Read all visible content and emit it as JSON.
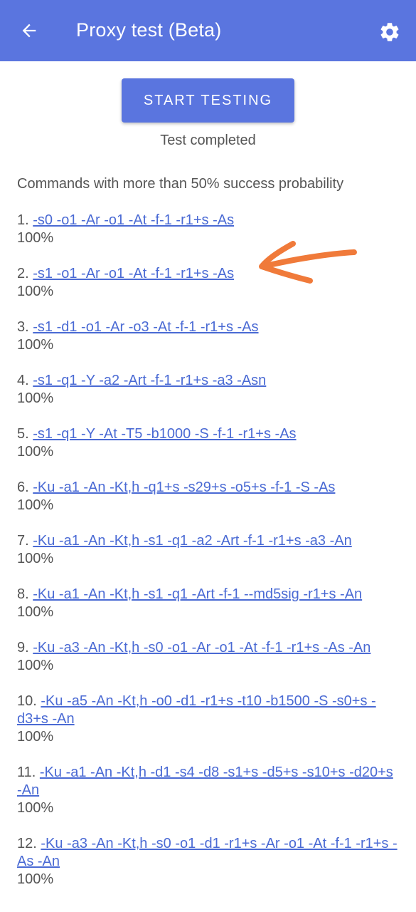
{
  "appbar": {
    "title": "Proxy test (Beta)",
    "back_icon": "arrow-back-icon",
    "settings_icon": "gear-icon",
    "color": "#5a75df"
  },
  "main": {
    "start_button_label": "START TESTING",
    "status": "Test completed",
    "heading": "Commands with more than 50% success probability",
    "results": [
      {
        "num": "1.",
        "command": "-s0 -o1 -Ar -o1 -At -f-1 -r1+s -As",
        "percent": "100%"
      },
      {
        "num": "2.",
        "command": "-s1 -o1 -Ar -o1 -At -f-1 -r1+s -As",
        "percent": "100%"
      },
      {
        "num": "3.",
        "command": "-s1 -d1 -o1 -Ar -o3 -At -f-1 -r1+s -As",
        "percent": "100%"
      },
      {
        "num": "4.",
        "command": "-s1 -q1 -Y -a2 -Art -f-1 -r1+s -a3 -Asn",
        "percent": "100%"
      },
      {
        "num": "5.",
        "command": "-s1 -q1 -Y -At -T5 -b1000 -S -f-1 -r1+s -As",
        "percent": "100%"
      },
      {
        "num": "6.",
        "command": "-Ku -a1 -An -Kt,h -q1+s -s29+s -o5+s -f-1 -S -As",
        "percent": "100%"
      },
      {
        "num": "7.",
        "command": "-Ku -a1 -An -Kt,h -s1 -q1 -a2 -Art -f-1 -r1+s -a3 -An",
        "percent": "100%"
      },
      {
        "num": "8.",
        "command": "-Ku -a1 -An -Kt,h -s1 -q1 -Art -f-1 --md5sig -r1+s -An",
        "percent": "100%"
      },
      {
        "num": "9.",
        "command": "-Ku -a3 -An -Kt,h -s0 -o1 -Ar -o1 -At -f-1 -r1+s -As -An",
        "percent": "100%"
      },
      {
        "num": "10.",
        "command": "-Ku -a5 -An -Kt,h -o0 -d1 -r1+s -t10 -b1500 -S -s0+s -d3+s -An",
        "percent": "100%"
      },
      {
        "num": "11.",
        "command": "-Ku -a1 -An -Kt,h -d1 -s4 -d8 -s1+s -d5+s -s10+s -d20+s -An",
        "percent": "100%"
      },
      {
        "num": "12.",
        "command": "-Ku -a3 -An -Kt,h -s0 -o1 -d1 -r1+s -Ar -o1 -At -f-1 -r1+s -As -An",
        "percent": "100%"
      }
    ]
  },
  "annotation": {
    "arrow_color": "#f07a3a",
    "arrow_icon": "hand-drawn-arrow-icon"
  }
}
